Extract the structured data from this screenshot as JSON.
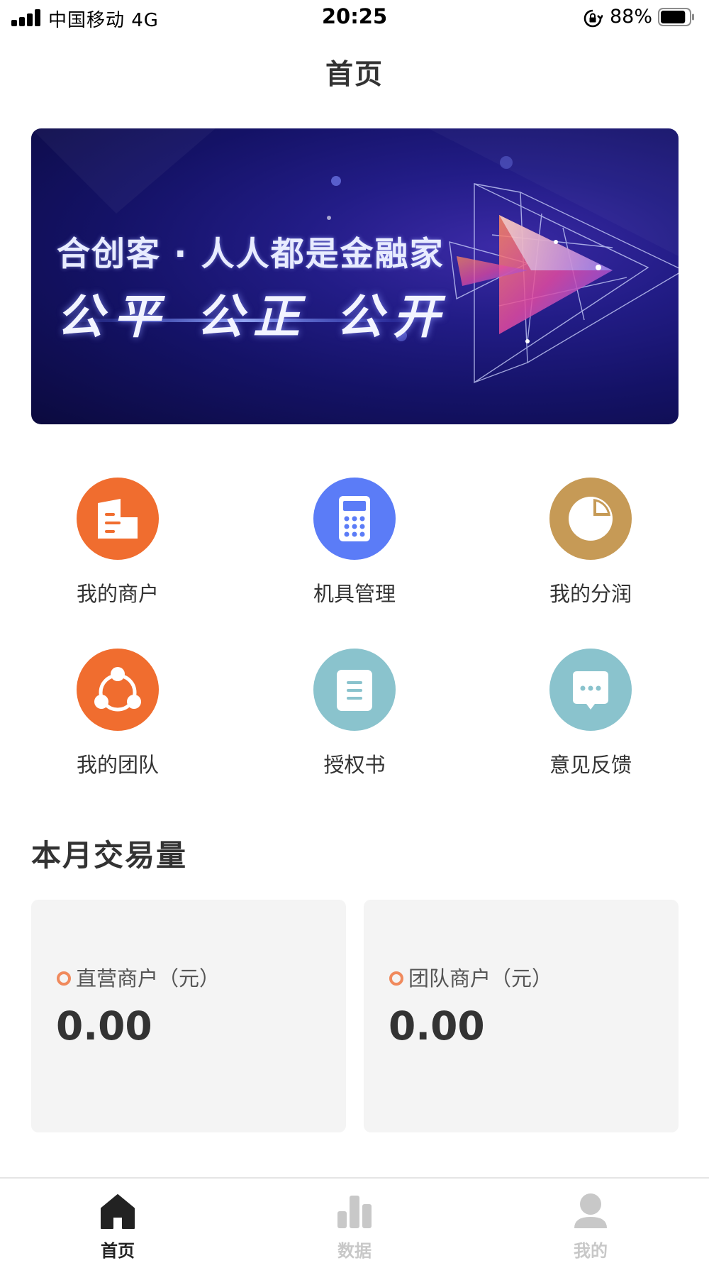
{
  "status_bar": {
    "carrier": "中国移动  4G",
    "time": "20:25",
    "battery": "88%",
    "battery_level": 0.88,
    "icons": [
      "signal-icon",
      "rotation-lock-icon",
      "battery-icon"
    ]
  },
  "nav": {
    "title": "首页"
  },
  "banner": {
    "line1": "合创客 · 人人都是金融家",
    "line2": "公平 公正 公开"
  },
  "menu": {
    "items": [
      {
        "label": "我的商户",
        "icon": "merchant-icon",
        "color": "#f06d2f"
      },
      {
        "label": "机具管理",
        "icon": "calculator-icon",
        "color": "#5b7cf7"
      },
      {
        "label": "我的分润",
        "icon": "pie-chart-icon",
        "color": "#c69a56"
      },
      {
        "label": "我的团队",
        "icon": "team-icon",
        "color": "#f06d2f"
      },
      {
        "label": "授权书",
        "icon": "document-icon",
        "color": "#8ac3cd"
      },
      {
        "label": "意见反馈",
        "icon": "chat-icon",
        "color": "#8ac3cd"
      }
    ]
  },
  "monthly": {
    "title": "本月交易量",
    "cards": [
      {
        "label": "直营商户（元）",
        "value": "0.00"
      },
      {
        "label": "团队商户（元）",
        "value": "0.00"
      }
    ]
  },
  "tabbar": {
    "active_color": "#222222",
    "inactive_color": "#c8c8c8",
    "tabs": [
      {
        "label": "首页",
        "icon": "home-icon",
        "active": true
      },
      {
        "label": "数据",
        "icon": "bar-chart-icon",
        "active": false
      },
      {
        "label": "我的",
        "icon": "user-icon",
        "active": false
      }
    ]
  }
}
